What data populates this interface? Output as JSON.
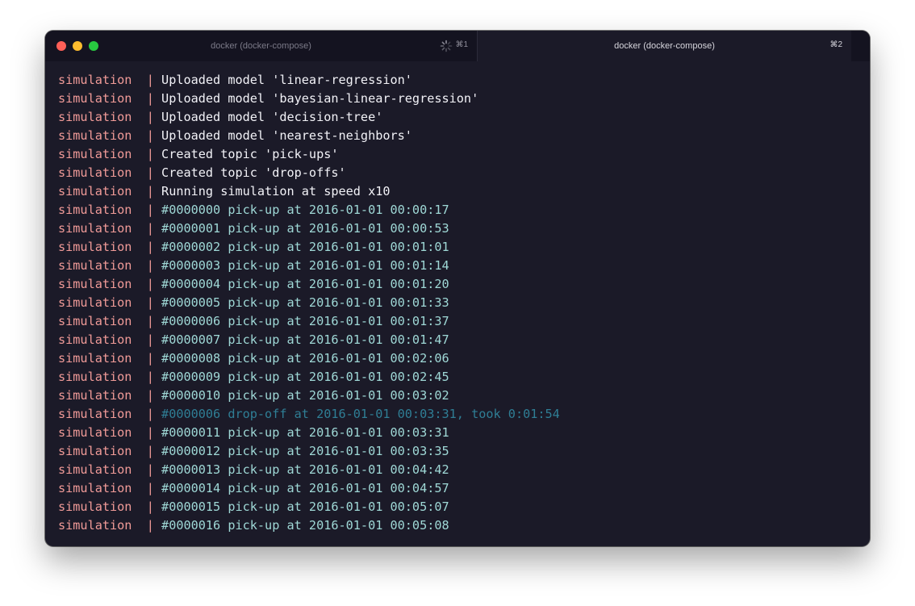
{
  "window": {
    "tabs": [
      {
        "title": "docker (docker-compose)",
        "shortcut": "⌘1",
        "active": false,
        "busy": true
      },
      {
        "title": "docker (docker-compose)",
        "shortcut": "⌘2",
        "active": true,
        "busy": false
      }
    ]
  },
  "colors": {
    "background": "#1b1a28",
    "service_prefix": "#f19b98",
    "info_text": "#f2f2f7",
    "pickup_text": "#9fd8d6",
    "dropoff_text": "#2f7e95"
  },
  "terminal": {
    "lines": [
      {
        "service": "simulation",
        "sep": "|",
        "kind": "info",
        "text": "Uploaded model 'linear-regression'"
      },
      {
        "service": "simulation",
        "sep": "|",
        "kind": "info",
        "text": "Uploaded model 'bayesian-linear-regression'"
      },
      {
        "service": "simulation",
        "sep": "|",
        "kind": "info",
        "text": "Uploaded model 'decision-tree'"
      },
      {
        "service": "simulation",
        "sep": "|",
        "kind": "info",
        "text": "Uploaded model 'nearest-neighbors'"
      },
      {
        "service": "simulation",
        "sep": "|",
        "kind": "info",
        "text": "Created topic 'pick-ups'"
      },
      {
        "service": "simulation",
        "sep": "|",
        "kind": "info",
        "text": "Created topic 'drop-offs'"
      },
      {
        "service": "simulation",
        "sep": "|",
        "kind": "info",
        "text": "Running simulation at speed x10"
      },
      {
        "service": "simulation",
        "sep": "|",
        "kind": "pickup",
        "text": "#0000000 pick-up at 2016-01-01 00:00:17"
      },
      {
        "service": "simulation",
        "sep": "|",
        "kind": "pickup",
        "text": "#0000001 pick-up at 2016-01-01 00:00:53"
      },
      {
        "service": "simulation",
        "sep": "|",
        "kind": "pickup",
        "text": "#0000002 pick-up at 2016-01-01 00:01:01"
      },
      {
        "service": "simulation",
        "sep": "|",
        "kind": "pickup",
        "text": "#0000003 pick-up at 2016-01-01 00:01:14"
      },
      {
        "service": "simulation",
        "sep": "|",
        "kind": "pickup",
        "text": "#0000004 pick-up at 2016-01-01 00:01:20"
      },
      {
        "service": "simulation",
        "sep": "|",
        "kind": "pickup",
        "text": "#0000005 pick-up at 2016-01-01 00:01:33"
      },
      {
        "service": "simulation",
        "sep": "|",
        "kind": "pickup",
        "text": "#0000006 pick-up at 2016-01-01 00:01:37"
      },
      {
        "service": "simulation",
        "sep": "|",
        "kind": "pickup",
        "text": "#0000007 pick-up at 2016-01-01 00:01:47"
      },
      {
        "service": "simulation",
        "sep": "|",
        "kind": "pickup",
        "text": "#0000008 pick-up at 2016-01-01 00:02:06"
      },
      {
        "service": "simulation",
        "sep": "|",
        "kind": "pickup",
        "text": "#0000009 pick-up at 2016-01-01 00:02:45"
      },
      {
        "service": "simulation",
        "sep": "|",
        "kind": "pickup",
        "text": "#0000010 pick-up at 2016-01-01 00:03:02"
      },
      {
        "service": "simulation",
        "sep": "|",
        "kind": "dropoff",
        "text": "#0000006 drop-off at 2016-01-01 00:03:31, took 0:01:54"
      },
      {
        "service": "simulation",
        "sep": "|",
        "kind": "pickup",
        "text": "#0000011 pick-up at 2016-01-01 00:03:31"
      },
      {
        "service": "simulation",
        "sep": "|",
        "kind": "pickup",
        "text": "#0000012 pick-up at 2016-01-01 00:03:35"
      },
      {
        "service": "simulation",
        "sep": "|",
        "kind": "pickup",
        "text": "#0000013 pick-up at 2016-01-01 00:04:42"
      },
      {
        "service": "simulation",
        "sep": "|",
        "kind": "pickup",
        "text": "#0000014 pick-up at 2016-01-01 00:04:57"
      },
      {
        "service": "simulation",
        "sep": "|",
        "kind": "pickup",
        "text": "#0000015 pick-up at 2016-01-01 00:05:07"
      },
      {
        "service": "simulation",
        "sep": "|",
        "kind": "pickup",
        "text": "#0000016 pick-up at 2016-01-01 00:05:08"
      }
    ]
  }
}
